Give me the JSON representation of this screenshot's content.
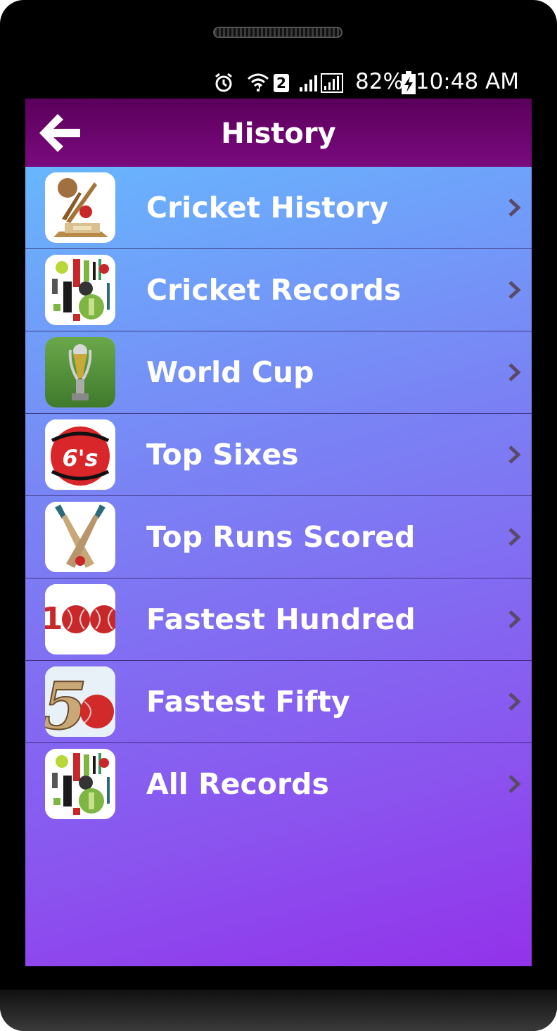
{
  "status_bar": {
    "sim_badge": "2",
    "battery": "82%",
    "time": "10:48 AM"
  },
  "header": {
    "title": "History"
  },
  "menu": [
    {
      "label": "Cricket History",
      "icon": "trophy-icon"
    },
    {
      "label": "Cricket Records",
      "icon": "cricket-collage-icon"
    },
    {
      "label": "World Cup",
      "icon": "world-cup-icon"
    },
    {
      "label": "Top Sixes",
      "icon": "sixes-ball-icon"
    },
    {
      "label": "Top Runs Scored",
      "icon": "crossed-bats-icon"
    },
    {
      "label": "Fastest Hundred",
      "icon": "hundred-icon"
    },
    {
      "label": "Fastest Fifty",
      "icon": "fifty-icon"
    },
    {
      "label": "All Records",
      "icon": "cricket-collage-icon"
    }
  ],
  "thumb_texts": {
    "sixes": "6's",
    "hundred_one": "1",
    "fifty": "5"
  },
  "colors": {
    "appbar": "#6a006c",
    "gradient_top": "#64c0ff",
    "gradient_bottom": "#9332ea",
    "chevron": "#5a4a6a"
  }
}
